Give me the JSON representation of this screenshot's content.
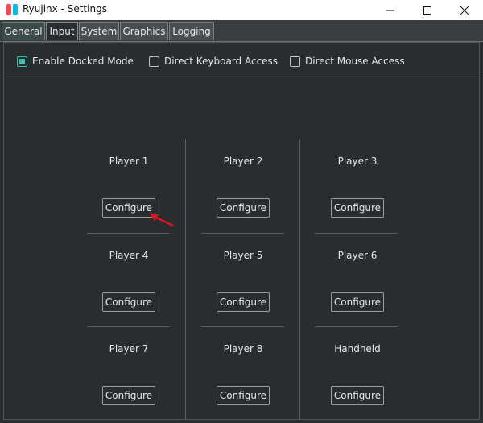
{
  "window": {
    "title": "Ryujinx - Settings",
    "minimize_glyph": "—",
    "maximize_glyph": "☐",
    "close_glyph": "✕"
  },
  "tabs": [
    {
      "label": "General"
    },
    {
      "label": "Input"
    },
    {
      "label": "System"
    },
    {
      "label": "Graphics"
    },
    {
      "label": "Logging"
    }
  ],
  "active_tab": "Input",
  "options": {
    "docked": {
      "label": "Enable Docked Mode",
      "checked": true
    },
    "keyboard": {
      "label": "Direct Keyboard Access",
      "checked": false
    },
    "mouse": {
      "label": "Direct Mouse Access",
      "checked": false
    }
  },
  "players": [
    {
      "label": "Player 1",
      "button": "Configure"
    },
    {
      "label": "Player 2",
      "button": "Configure"
    },
    {
      "label": "Player 3",
      "button": "Configure"
    },
    {
      "label": "Player 4",
      "button": "Configure"
    },
    {
      "label": "Player 5",
      "button": "Configure"
    },
    {
      "label": "Player 6",
      "button": "Configure"
    },
    {
      "label": "Player 7",
      "button": "Configure"
    },
    {
      "label": "Player 8",
      "button": "Configure"
    },
    {
      "label": "Handheld",
      "button": "Configure"
    }
  ],
  "colors": {
    "background": "#2a2d30",
    "accent": "#3fbfa9",
    "annotation_arrow": "#e0141e"
  },
  "icons": {
    "app": "ryujinx-logo-icon",
    "annotation": "red-arrow-icon"
  }
}
